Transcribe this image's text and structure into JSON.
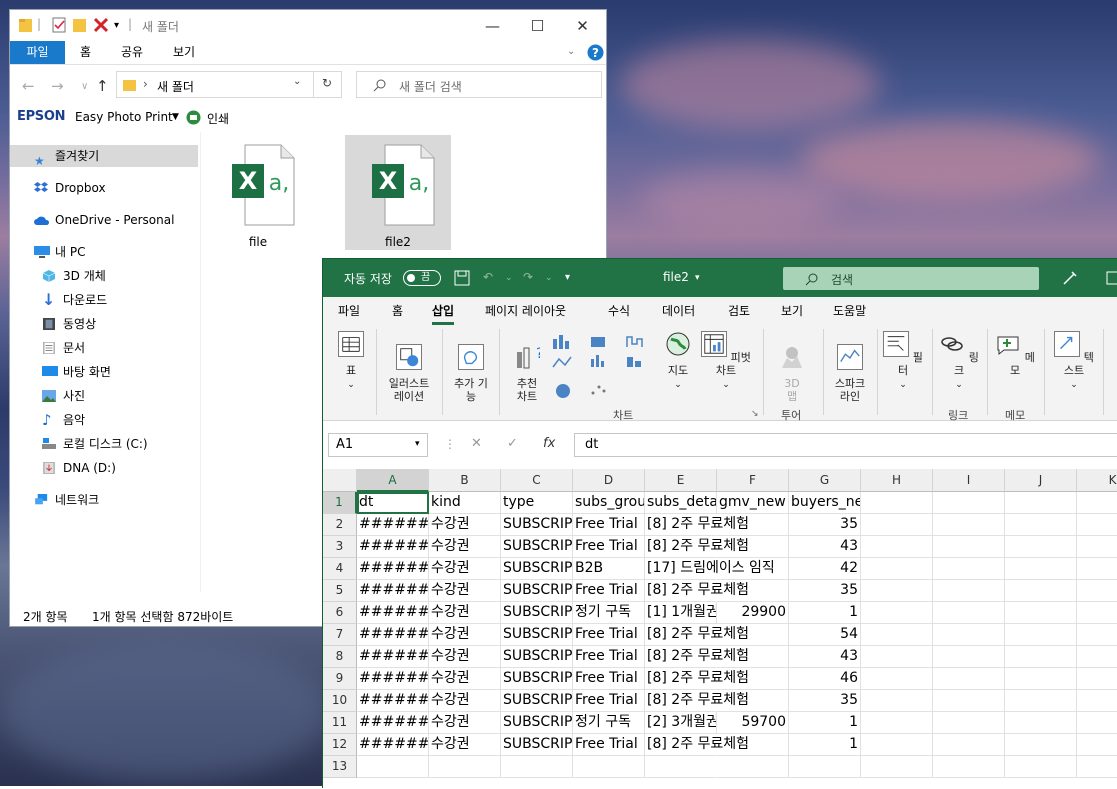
{
  "explorer": {
    "title": "새 폴더",
    "ribbon_tabs": [
      "파일",
      "홈",
      "공유",
      "보기"
    ],
    "address": "새 폴더",
    "search_placeholder": "새 폴더 검색",
    "epson_logo": "EPSON",
    "epson_app": "Easy Photo Print",
    "print_label": "인쇄",
    "sidebar": [
      {
        "label": "즐겨찾기",
        "icon": "star-icon"
      },
      {
        "label": "Dropbox",
        "icon": "dropbox-icon"
      },
      {
        "label": "OneDrive - Personal",
        "icon": "cloud-icon"
      },
      {
        "label": "내 PC",
        "icon": "pc-icon"
      },
      {
        "label": "3D 개체",
        "icon": "cube-icon"
      },
      {
        "label": "다운로드",
        "icon": "download-icon"
      },
      {
        "label": "동영상",
        "icon": "film-icon"
      },
      {
        "label": "문서",
        "icon": "document-icon"
      },
      {
        "label": "바탕 화면",
        "icon": "desktop-icon"
      },
      {
        "label": "사진",
        "icon": "picture-icon"
      },
      {
        "label": "음악",
        "icon": "music-icon"
      },
      {
        "label": "로컬 디스크 (C:)",
        "icon": "drive-icon"
      },
      {
        "label": "DNA (D:)",
        "icon": "drive-icon"
      },
      {
        "label": "네트워크",
        "icon": "network-icon"
      }
    ],
    "files": [
      "file",
      "file2"
    ],
    "status_count": "2개 항목",
    "status_selected": "1개 항목 선택함 872바이트"
  },
  "excel": {
    "autosave_label": "자동 저장",
    "autosave_state": "끔",
    "file_title": "file2",
    "search_placeholder": "검색",
    "tabs": [
      "파일",
      "홈",
      "삽입",
      "페이지 레이아웃",
      "수식",
      "데이터",
      "검토",
      "보기",
      "도움말"
    ],
    "ribbon": {
      "table": "표",
      "illustrations": "일러스트\n레이션",
      "addins": "추가 기\n능",
      "recommended_charts": "추천\n차트",
      "maps": "지도",
      "pivot_chart": "피벗 차트",
      "map3d": "3D\n맵",
      "sparklines": "스파크\n라인",
      "filter": "필터",
      "link": "링크",
      "comment": "메모",
      "text": "텍스트",
      "group_charts": "차트",
      "group_tours": "투어",
      "group_links": "링크",
      "group_comments": "메모"
    },
    "name_box": "A1",
    "formula": "dt",
    "columns": [
      "A",
      "B",
      "C",
      "D",
      "E",
      "F",
      "G",
      "H",
      "I",
      "J",
      "K"
    ],
    "rows": [
      [
        "dt",
        "kind",
        "type",
        "subs_grou",
        "subs_detai",
        "gmv_new",
        "buyers_new"
      ],
      [
        "#######",
        "수강권",
        "SUBSCRIP",
        "Free Trial",
        "[8] 2주 무료체험",
        "",
        "35"
      ],
      [
        "#######",
        "수강권",
        "SUBSCRIP",
        "Free Trial",
        "[8] 2주 무료체험",
        "",
        "43"
      ],
      [
        "#######",
        "수강권",
        "SUBSCRIP",
        "B2B",
        "[17] 드림에이스 임직",
        "",
        "42"
      ],
      [
        "#######",
        "수강권",
        "SUBSCRIP",
        "Free Trial",
        "[8] 2주 무료체험",
        "",
        "35"
      ],
      [
        "#######",
        "수강권",
        "SUBSCRIP",
        "정기 구독",
        "[1] 1개월권",
        "29900",
        "1"
      ],
      [
        "#######",
        "수강권",
        "SUBSCRIP",
        "Free Trial",
        "[8] 2주 무료체험",
        "",
        "54"
      ],
      [
        "#######",
        "수강권",
        "SUBSCRIP",
        "Free Trial",
        "[8] 2주 무료체험",
        "",
        "43"
      ],
      [
        "#######",
        "수강권",
        "SUBSCRIP",
        "Free Trial",
        "[8] 2주 무료체험",
        "",
        "46"
      ],
      [
        "#######",
        "수강권",
        "SUBSCRIP",
        "Free Trial",
        "[8] 2주 무료체험",
        "",
        "35"
      ],
      [
        "#######",
        "수강권",
        "SUBSCRIP",
        "정기 구독",
        "[2] 3개월권",
        "59700",
        "1"
      ],
      [
        "#######",
        "수강권",
        "SUBSCRIP",
        "Free Trial",
        "[8] 2주 무료체험",
        "",
        "1"
      ],
      [
        "",
        "",
        "",
        "",
        "",
        "",
        ""
      ]
    ]
  }
}
